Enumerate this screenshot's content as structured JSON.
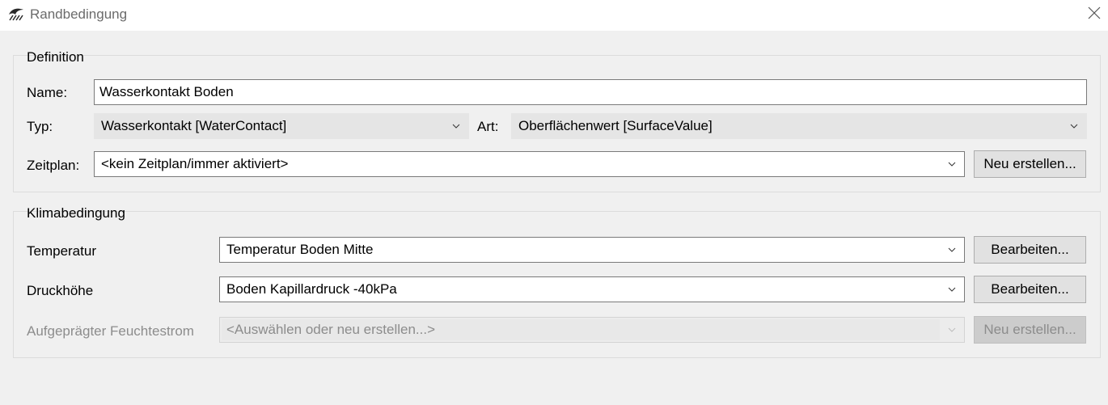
{
  "window": {
    "title": "Randbedingung"
  },
  "definition": {
    "group_title": "Definition",
    "name_label": "Name:",
    "name_value": "Wasserkontakt Boden",
    "typ_label": "Typ:",
    "typ_value": "Wasserkontakt [WaterContact]",
    "art_label": "Art:",
    "art_value": "Oberflächenwert [SurfaceValue]",
    "zeitplan_label": "Zeitplan:",
    "zeitplan_value": "<kein Zeitplan/immer aktiviert>",
    "zeitplan_button": "Neu erstellen..."
  },
  "klima": {
    "group_title": "Klimabedingung",
    "rows": [
      {
        "label": "Temperatur",
        "value": "Temperatur Boden Mitte",
        "button": "Bearbeiten...",
        "enabled": true
      },
      {
        "label": "Druckhöhe",
        "value": "Boden Kapillardruck -40kPa",
        "button": "Bearbeiten...",
        "enabled": true
      },
      {
        "label": "Aufgeprägter Feuchtestrom",
        "value": "<Auswählen oder neu erstellen...>",
        "button": "Neu erstellen...",
        "enabled": false
      }
    ]
  },
  "icons": {
    "app": "water-wave-icon",
    "close": "close-icon",
    "dropdown": "chevron-down-icon"
  }
}
